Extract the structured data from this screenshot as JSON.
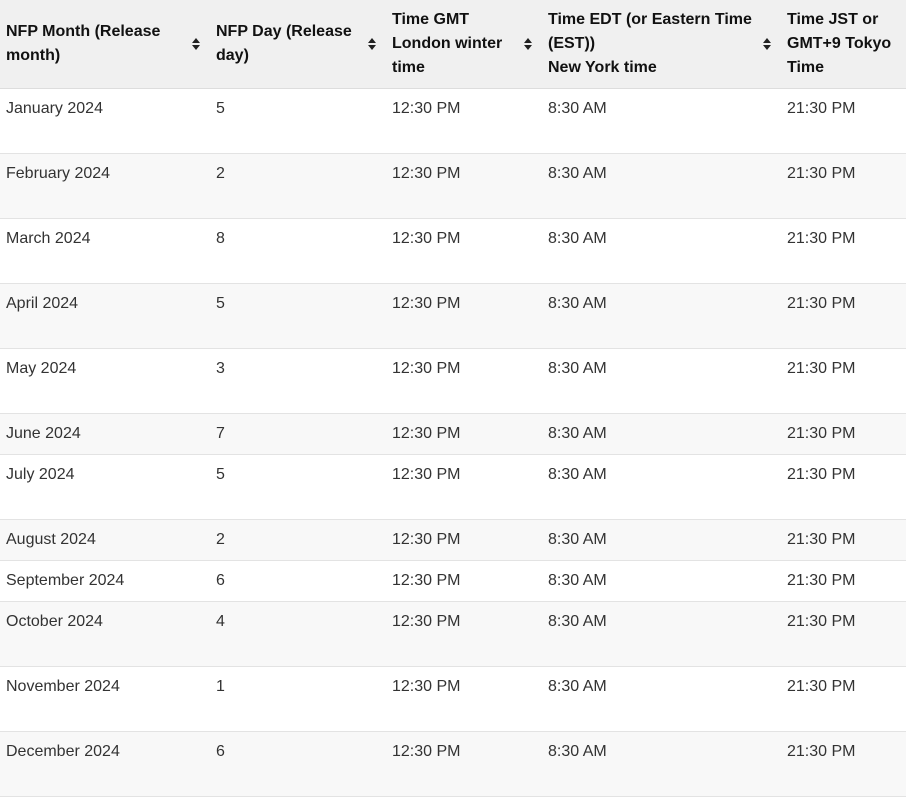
{
  "table": {
    "headers": [
      "NFP Month (Release month)",
      "NFP Day (Release day)",
      "Time GMT London winter time",
      "Time EDT (or Eastern Time (EST))\nNew York time",
      "Time JST or GMT+9 Tokyo Time"
    ],
    "sortable": [
      true,
      true,
      true,
      true,
      false
    ],
    "rows": [
      [
        "January 2024",
        "5",
        "12:30 PM",
        "8:30 AM",
        "21:30 PM"
      ],
      [
        "February 2024",
        "2",
        "12:30 PM",
        "8:30 AM",
        "21:30 PM"
      ],
      [
        "March 2024",
        "8",
        "12:30 PM",
        "8:30 AM",
        "21:30 PM"
      ],
      [
        "April 2024",
        "5",
        "12:30 PM",
        "8:30 AM",
        "21:30 PM"
      ],
      [
        "May 2024",
        "3",
        "12:30 PM",
        "8:30 AM",
        "21:30 PM"
      ],
      [
        "June 2024",
        "7",
        "12:30 PM",
        "8:30 AM",
        "21:30 PM"
      ],
      [
        "July 2024",
        "5",
        "12:30 PM",
        "8:30 AM",
        "21:30 PM"
      ],
      [
        "August 2024",
        "2",
        "12:30 PM",
        "8:30 AM",
        "21:30 PM"
      ],
      [
        "September 2024",
        "6",
        "12:30 PM",
        "8:30 AM",
        "21:30 PM"
      ],
      [
        "October 2024",
        "4",
        "12:30 PM",
        "8:30 AM",
        "21:30 PM"
      ],
      [
        "November 2024",
        "1",
        "12:30 PM",
        "8:30 AM",
        "21:30 PM"
      ],
      [
        "December 2024",
        "6",
        "12:30 PM",
        "8:30 AM",
        "21:30 PM"
      ]
    ]
  }
}
